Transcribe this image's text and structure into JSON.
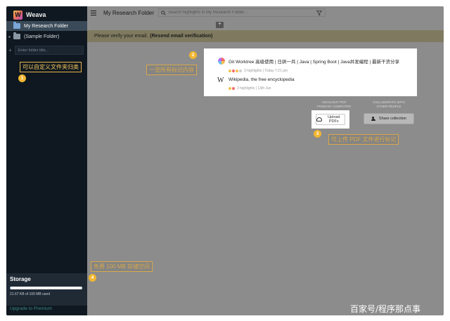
{
  "app": {
    "brand": "Weava",
    "title": "My Research Folder"
  },
  "search": {
    "placeholder": "Search highlights in My Research Folder..."
  },
  "sidebar": {
    "folders": [
      {
        "label": "My Research Folder",
        "selected": true
      },
      {
        "label": "(Sample Folder)",
        "selected": false
      }
    ],
    "filter_placeholder": "Enter folder title...",
    "storage_title": "Storage",
    "storage_used_fraction": 0.0002167,
    "storage_usage": "21.67 KB of 100 MB used",
    "upgrade_label": "Upgrade to Premium"
  },
  "banner": {
    "text": "Please verify your email.",
    "action": "(Resend email verification)"
  },
  "highlights": [
    {
      "title": "Git Worktree 高级使用 | 日拱一兵 | Java | Spring Boot | Java并发编程 | 最新干货分享",
      "meta": "3 highlights | Today 7:21 pm",
      "icon": "git-favicon-icon",
      "dot_colors": [
        "#f2c14e",
        "#f26b6b",
        "#f2c14e",
        "#cfcfcf"
      ]
    },
    {
      "title": "Wikipedia, the free encyclopedia",
      "meta": "2 highlights | 13th Jun",
      "icon": "wikipedia-icon",
      "dot_colors": [
        "#f2c14e",
        "#f26b6b"
      ]
    }
  ],
  "upload": {
    "caption": [
      "HIGHLIGHT PDF",
      "FROM MY COMPUTER"
    ],
    "label": "Upload PDFs",
    "share_caption": [
      "COLLABORATE WITH",
      "OTHER PEOPLE"
    ],
    "share_label": "Share collection"
  },
  "annotations": {
    "tip1": "可以自定义文件夹归类",
    "tip2": "一览所有标记内容",
    "tip3": "可上传 PDF 文件进行标记",
    "tip4": "免费 100 MB 存储空间",
    "badge1": "1",
    "badge2": "2",
    "badge3": "3",
    "badge4": "4"
  },
  "watermark": "百家号/程序那点事",
  "colors": {
    "accent_folder": "#7aa7d8",
    "annotation": "#f2b630",
    "sidebar_bg": "#0f1820"
  }
}
